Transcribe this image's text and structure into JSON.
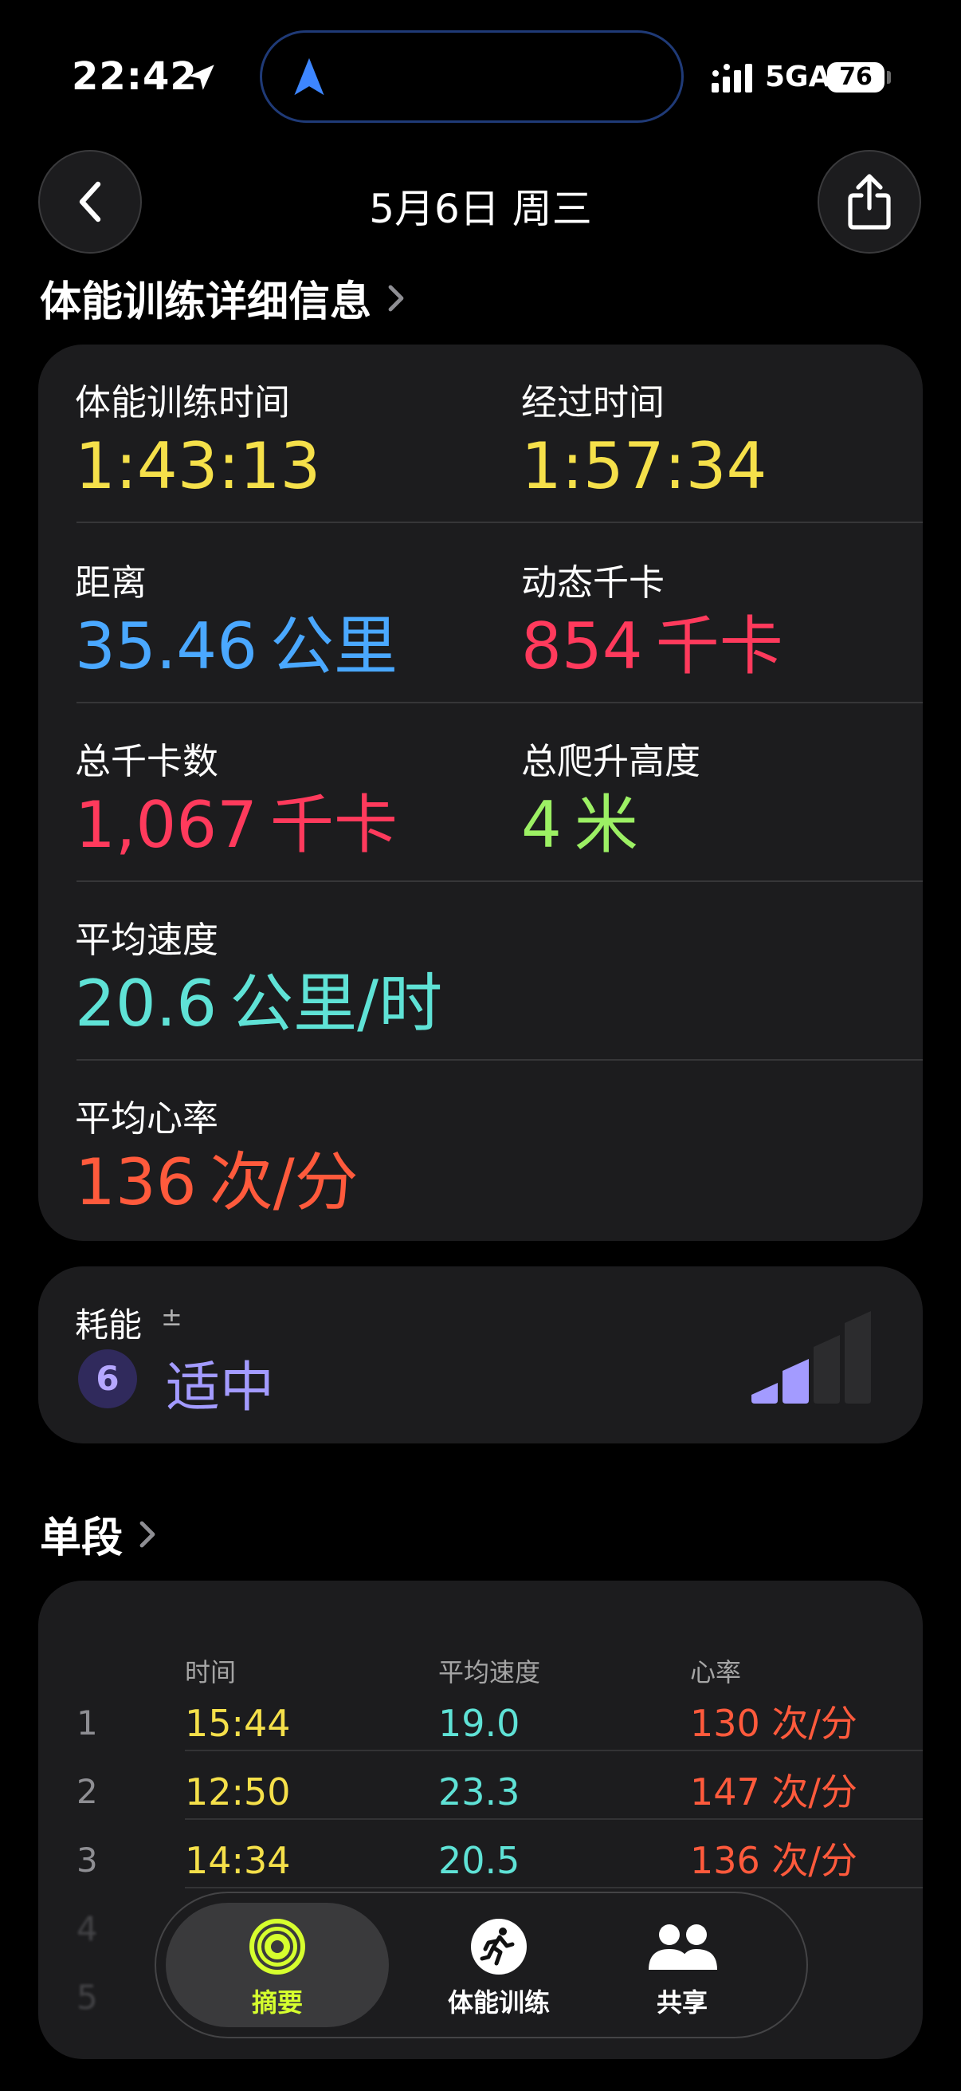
{
  "status_bar": {
    "time": "22:42",
    "network": "5GA",
    "battery": "76"
  },
  "header": {
    "title": "5月6日 周三"
  },
  "details": {
    "section_title": "体能训练详细信息",
    "metrics": {
      "workout_time": {
        "label": "体能训练时间",
        "value": "1:43:13",
        "unit": ""
      },
      "elapsed_time": {
        "label": "经过时间",
        "value": "1:57:34",
        "unit": ""
      },
      "distance": {
        "label": "距离",
        "value": "35.46",
        "unit": "公里"
      },
      "active_kcal": {
        "label": "动态千卡",
        "value": "854",
        "unit": "千卡"
      },
      "total_kcal": {
        "label": "总千卡数",
        "value": "1,067",
        "unit": "千卡"
      },
      "elevation": {
        "label": "总爬升高度",
        "value": "4",
        "unit": "米"
      },
      "avg_speed": {
        "label": "平均速度",
        "value": "20.6",
        "unit": "公里/时"
      },
      "avg_hr": {
        "label": "平均心率",
        "value": "136",
        "unit": "次/分"
      }
    }
  },
  "effort": {
    "label": "耗能",
    "plus_minus": "±",
    "score": "6",
    "level_text": "适中",
    "level_bars": 2,
    "total_bars": 4
  },
  "splits": {
    "section_title": "单段",
    "headers": {
      "time": "时间",
      "speed": "平均速度",
      "hr": "心率"
    },
    "rows": [
      {
        "idx": "1",
        "time": "15:44",
        "speed": "19.0",
        "hr": "130 次/分"
      },
      {
        "idx": "2",
        "time": "12:50",
        "speed": "23.3",
        "hr": "147 次/分"
      },
      {
        "idx": "3",
        "time": "14:34",
        "speed": "20.5",
        "hr": "136 次/分"
      },
      {
        "idx": "4",
        "time": "",
        "speed": "",
        "hr": ""
      },
      {
        "idx": "5",
        "time": "",
        "speed": "",
        "hr": ""
      }
    ]
  },
  "tab_bar": {
    "tabs": [
      {
        "label": "摘要",
        "icon": "activity-rings-icon",
        "active": true
      },
      {
        "label": "体能训练",
        "icon": "running-figure-icon",
        "active": false
      },
      {
        "label": "共享",
        "icon": "people-icon",
        "active": false
      }
    ]
  },
  "colors": {
    "yellow": "#f5e04a",
    "blue": "#4aa8ff",
    "pink": "#ff3a5c",
    "green": "#9cf064",
    "cyan": "#5fe2d6",
    "orange_red": "#ff5a3c",
    "purple": "#a39bff"
  }
}
